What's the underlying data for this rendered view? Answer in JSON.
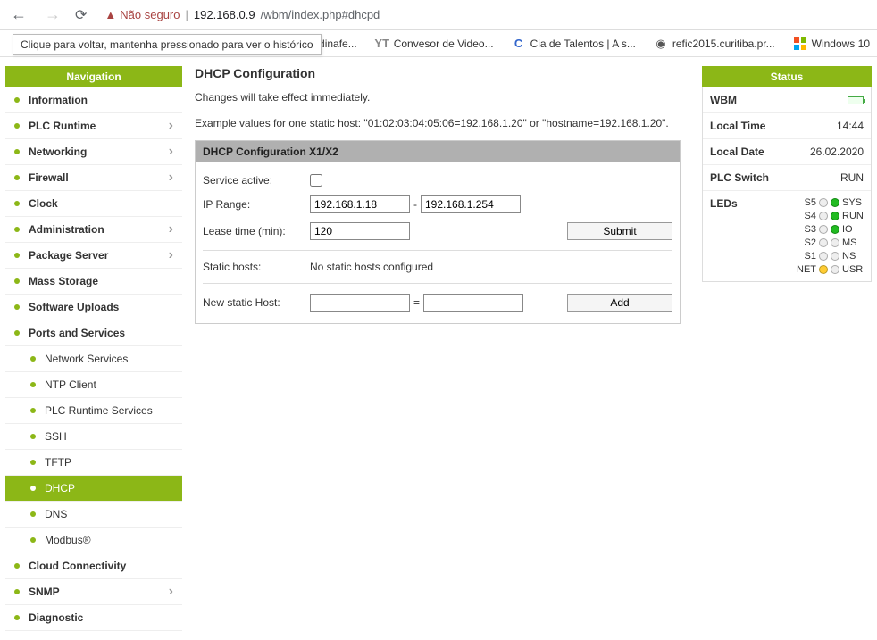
{
  "browser": {
    "not_secure": "Não seguro",
    "host": "192.168.0.9",
    "path": "/wbm/index.php#dhcpd",
    "tooltip": "Clique para voltar, mantenha pressionado para ver o histórico"
  },
  "bookmarks": [
    {
      "label": "dinafe...",
      "icon": ""
    },
    {
      "label": "Convesor de Video...",
      "icon": "YT"
    },
    {
      "label": "Cia de Talentos | A s...",
      "icon": "C"
    },
    {
      "label": "refic2015.curitiba.pr...",
      "icon": "◉"
    },
    {
      "label": "Windows 10",
      "icon": "⊞"
    }
  ],
  "nav": {
    "header": "Navigation",
    "items": [
      {
        "label": "Information",
        "chevron": false
      },
      {
        "label": "PLC Runtime",
        "chevron": true
      },
      {
        "label": "Networking",
        "chevron": true
      },
      {
        "label": "Firewall",
        "chevron": true
      },
      {
        "label": "Clock",
        "chevron": false
      },
      {
        "label": "Administration",
        "chevron": true
      },
      {
        "label": "Package Server",
        "chevron": true
      },
      {
        "label": "Mass Storage",
        "chevron": false
      },
      {
        "label": "Software Uploads",
        "chevron": false
      },
      {
        "label": "Ports and Services",
        "chevron": false
      }
    ],
    "subitems": [
      {
        "label": "Network Services"
      },
      {
        "label": "NTP Client"
      },
      {
        "label": "PLC Runtime Services"
      },
      {
        "label": "SSH"
      },
      {
        "label": "TFTP"
      },
      {
        "label": "DHCP",
        "active": true
      },
      {
        "label": "DNS"
      },
      {
        "label": "Modbus®"
      }
    ],
    "tail": [
      {
        "label": "Cloud Connectivity",
        "chevron": false
      },
      {
        "label": "SNMP",
        "chevron": true
      },
      {
        "label": "Diagnostic",
        "chevron": false
      }
    ]
  },
  "content": {
    "title": "DHCP Configuration",
    "note": "Changes will take effect immediately.",
    "example": "Example values for one static host: \"01:02:03:04:05:06=192.168.1.20\" or \"hostname=192.168.1.20\".",
    "panel_title": "DHCP Configuration X1/X2",
    "labels": {
      "service_active": "Service active:",
      "ip_range": "IP Range:",
      "lease_time": "Lease time (min):",
      "static_hosts": "Static hosts:",
      "new_static_host": "New static Host:"
    },
    "values": {
      "ip_from": "192.168.1.18",
      "ip_to": "192.168.1.254",
      "lease_time": "120",
      "static_hosts_msg": "No static hosts configured",
      "range_sep": "-",
      "host_sep": "="
    },
    "buttons": {
      "submit": "Submit",
      "add": "Add"
    }
  },
  "status": {
    "header": "Status",
    "wbm": "WBM",
    "local_time_label": "Local Time",
    "local_time": "14:44",
    "local_date_label": "Local Date",
    "local_date": "26.02.2020",
    "plc_switch_label": "PLC Switch",
    "plc_switch": "RUN",
    "leds_label": "LEDs",
    "leds": [
      {
        "l": "S5",
        "c1": "off",
        "r": "SYS",
        "c2": "green"
      },
      {
        "l": "S4",
        "c1": "off",
        "r": "RUN",
        "c2": "green"
      },
      {
        "l": "S3",
        "c1": "off",
        "r": "IO",
        "c2": "green"
      },
      {
        "l": "S2",
        "c1": "off",
        "r": "MS",
        "c2": "off"
      },
      {
        "l": "S1",
        "c1": "off",
        "r": "NS",
        "c2": "off"
      },
      {
        "l": "NET",
        "c1": "yellow",
        "r": "USR",
        "c2": "off"
      }
    ]
  }
}
